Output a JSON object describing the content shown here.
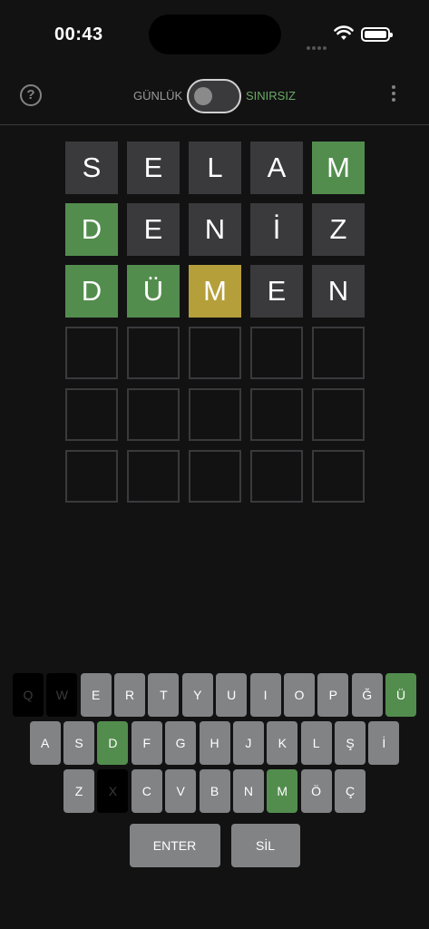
{
  "status_bar": {
    "time": "00:43"
  },
  "header": {
    "mode_daily": "GÜNLÜK",
    "mode_unlimited": "SINIRSIZ",
    "accent_color": "#6aaa64"
  },
  "board": {
    "rows": [
      [
        {
          "letter": "S",
          "state": "absent"
        },
        {
          "letter": "E",
          "state": "absent"
        },
        {
          "letter": "L",
          "state": "absent"
        },
        {
          "letter": "A",
          "state": "absent"
        },
        {
          "letter": "M",
          "state": "correct"
        }
      ],
      [
        {
          "letter": "D",
          "state": "correct"
        },
        {
          "letter": "E",
          "state": "absent"
        },
        {
          "letter": "N",
          "state": "absent"
        },
        {
          "letter": "İ",
          "state": "absent"
        },
        {
          "letter": "Z",
          "state": "absent"
        }
      ],
      [
        {
          "letter": "D",
          "state": "correct"
        },
        {
          "letter": "Ü",
          "state": "correct"
        },
        {
          "letter": "M",
          "state": "present"
        },
        {
          "letter": "E",
          "state": "absent"
        },
        {
          "letter": "N",
          "state": "absent"
        }
      ],
      [
        {
          "letter": "",
          "state": "empty"
        },
        {
          "letter": "",
          "state": "empty"
        },
        {
          "letter": "",
          "state": "empty"
        },
        {
          "letter": "",
          "state": "empty"
        },
        {
          "letter": "",
          "state": "empty"
        }
      ],
      [
        {
          "letter": "",
          "state": "empty"
        },
        {
          "letter": "",
          "state": "empty"
        },
        {
          "letter": "",
          "state": "empty"
        },
        {
          "letter": "",
          "state": "empty"
        },
        {
          "letter": "",
          "state": "empty"
        }
      ],
      [
        {
          "letter": "",
          "state": "empty"
        },
        {
          "letter": "",
          "state": "empty"
        },
        {
          "letter": "",
          "state": "empty"
        },
        {
          "letter": "",
          "state": "empty"
        },
        {
          "letter": "",
          "state": "empty"
        }
      ]
    ],
    "colors": {
      "correct": "#538d4e",
      "present": "#b59f3b",
      "absent": "#3a3a3c"
    }
  },
  "keyboard": {
    "rows": [
      [
        {
          "label": "Q",
          "state": "dead"
        },
        {
          "label": "W",
          "state": "dead"
        },
        {
          "label": "E",
          "state": "normal"
        },
        {
          "label": "R",
          "state": "normal"
        },
        {
          "label": "T",
          "state": "normal"
        },
        {
          "label": "Y",
          "state": "normal"
        },
        {
          "label": "U",
          "state": "normal"
        },
        {
          "label": "I",
          "state": "normal"
        },
        {
          "label": "O",
          "state": "normal"
        },
        {
          "label": "P",
          "state": "normal"
        },
        {
          "label": "Ğ",
          "state": "normal"
        },
        {
          "label": "Ü",
          "state": "correct"
        }
      ],
      [
        {
          "label": "A",
          "state": "normal"
        },
        {
          "label": "S",
          "state": "normal"
        },
        {
          "label": "D",
          "state": "correct"
        },
        {
          "label": "F",
          "state": "normal"
        },
        {
          "label": "G",
          "state": "normal"
        },
        {
          "label": "H",
          "state": "normal"
        },
        {
          "label": "J",
          "state": "normal"
        },
        {
          "label": "K",
          "state": "normal"
        },
        {
          "label": "L",
          "state": "normal"
        },
        {
          "label": "Ş",
          "state": "normal"
        },
        {
          "label": "İ",
          "state": "normal"
        }
      ],
      [
        {
          "label": "Z",
          "state": "normal"
        },
        {
          "label": "X",
          "state": "dead"
        },
        {
          "label": "C",
          "state": "normal"
        },
        {
          "label": "V",
          "state": "normal"
        },
        {
          "label": "B",
          "state": "normal"
        },
        {
          "label": "N",
          "state": "normal"
        },
        {
          "label": "M",
          "state": "correct"
        },
        {
          "label": "Ö",
          "state": "normal"
        },
        {
          "label": "Ç",
          "state": "normal"
        }
      ],
      [
        {
          "label": "ENTER",
          "state": "wide"
        },
        {
          "label": "SİL",
          "state": "mid"
        }
      ]
    ]
  }
}
